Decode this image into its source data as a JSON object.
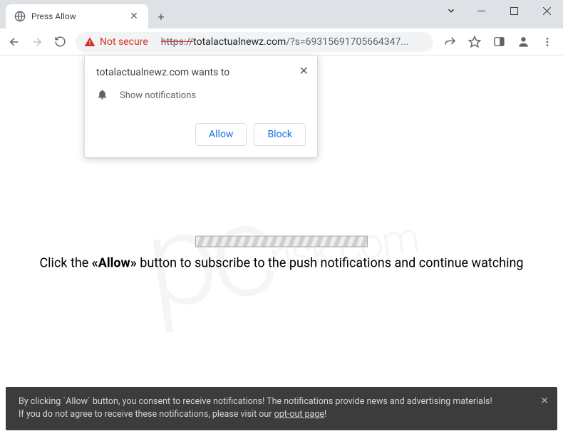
{
  "tab": {
    "title": "Press Allow"
  },
  "address": {
    "not_secure": "Not secure",
    "protocol": "https://",
    "domain": "totalactualnewz.com",
    "path": "/?s=69315691705664347..."
  },
  "prompt": {
    "header": "totalactualnewz.com wants to",
    "body": "Show notifications",
    "allow": "Allow",
    "block": "Block"
  },
  "page": {
    "text_before": "Click the ",
    "text_strong": "«Allow»",
    "text_after": " button to subscribe to the push notifications and continue watching"
  },
  "bottombar": {
    "line1": "By clicking `Allow` button, you consent to receive notifications! The notifications provide news and advertising materials!",
    "line2a": "If you do not agree to receive these notifications, please visit our ",
    "link": "opt-out page",
    "line2b": "!"
  },
  "watermark": {
    "big": "pc",
    "small": "risk.com"
  }
}
